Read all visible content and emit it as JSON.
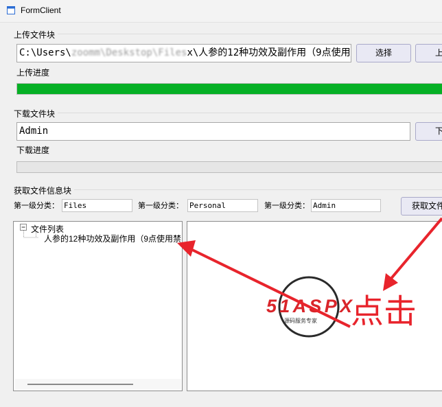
{
  "window": {
    "title": "FormClient"
  },
  "upload": {
    "group_label": "上传文件块",
    "path_prefix": "C:\\Users\\",
    "path_blurred": "zoomm\\Deskstop\\Files",
    "path_suffix": "x\\人参的12种功效及副作用（9点使用",
    "choose_button": "选择",
    "upload_button": "上",
    "progress_label": "上传进度",
    "progress": 1.0
  },
  "download": {
    "group_label": "下载文件块",
    "name_value": "Admin",
    "download_button": "下",
    "progress_label": "下载进度",
    "progress": 0.0
  },
  "info": {
    "group_label": "获取文件信息块",
    "filters": [
      {
        "label": "第一级分类：",
        "value": "Files"
      },
      {
        "label": "第一级分类：",
        "value": "Personal"
      },
      {
        "label": "第一级分类：",
        "value": "Admin"
      }
    ],
    "get_button": "获取文件"
  },
  "tree": {
    "root_label": "文件列表",
    "items": [
      "人参的12种功效及副作用（9点使用禁"
    ]
  },
  "overlay": {
    "watermark_text": "51ASPX",
    "watermark_sub": "源码服务专家",
    "annotation_text": "点击",
    "arrow_color": "#e8242c",
    "watermark_color": "#d9252a",
    "watermark_accent": "#1a9a3a"
  },
  "colors": {
    "progress_fill": "#06b025"
  }
}
